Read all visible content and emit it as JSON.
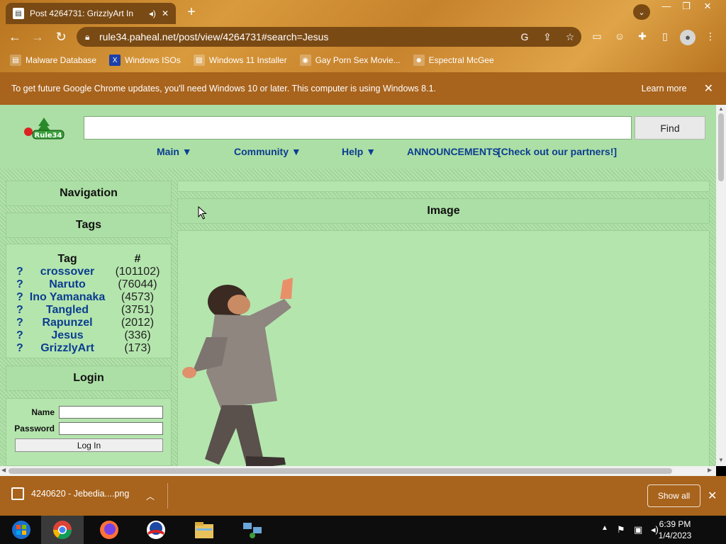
{
  "browser": {
    "tab": {
      "title": "Post 4264731: GrizzlyArt In",
      "favicon": "document-favicon"
    },
    "url": "rule34.paheal.net/post/view/4264731#search=Jesus",
    "bookmarks": [
      {
        "label": "Malware Database",
        "icon": "folder-icon"
      },
      {
        "label": "Windows ISOs",
        "icon": "x-icon"
      },
      {
        "label": "Windows 11 Installer",
        "icon": "image-icon"
      },
      {
        "label": "Gay Porn Sex Movie...",
        "icon": "globe-icon"
      },
      {
        "label": "Espectral McGee",
        "icon": "face-icon"
      }
    ]
  },
  "infobar": {
    "message": "To get future Google Chrome updates, you'll need Windows 10 or later. This computer is using Windows 8.1.",
    "learn_more": "Learn more"
  },
  "site": {
    "logo_text": "Rule34",
    "search": {
      "value": "",
      "find_label": "Find"
    },
    "menu": [
      {
        "label": "Main ▼"
      },
      {
        "label": "Community ▼"
      },
      {
        "label": "Help ▼"
      },
      {
        "label": "ANNOUNCEMENTS"
      },
      {
        "label": "[Check out our partners!]"
      }
    ],
    "sidebar": {
      "navigation_title": "Navigation",
      "tags_title": "Tags",
      "tags_header": {
        "tag": "Tag",
        "count": "#"
      },
      "tags": [
        {
          "q": "?",
          "name": "crossover",
          "count": "(101102)"
        },
        {
          "q": "?",
          "name": "Naruto",
          "count": "(76044)"
        },
        {
          "q": "?",
          "name": "Ino Yamanaka",
          "count": "(4573)"
        },
        {
          "q": "?",
          "name": "Tangled",
          "count": "(3751)"
        },
        {
          "q": "?",
          "name": "Rapunzel",
          "count": "(2012)"
        },
        {
          "q": "?",
          "name": "Jesus",
          "count": "(336)"
        },
        {
          "q": "?",
          "name": "GrizzlyArt",
          "count": "(173)"
        }
      ],
      "login_title": "Login",
      "login": {
        "name_label": "Name",
        "password_label": "Password",
        "button": "Log In"
      }
    },
    "main": {
      "image_title": "Image"
    }
  },
  "downloads": {
    "file": "4240620 - Jebedia....png",
    "show_all": "Show all"
  },
  "taskbar": {
    "time": "6:39 PM",
    "date": "1/4/2023"
  },
  "colors": {
    "page_bg": "#acdfa5",
    "chrome_accent": "#a8631c",
    "link": "#0b3d91"
  }
}
